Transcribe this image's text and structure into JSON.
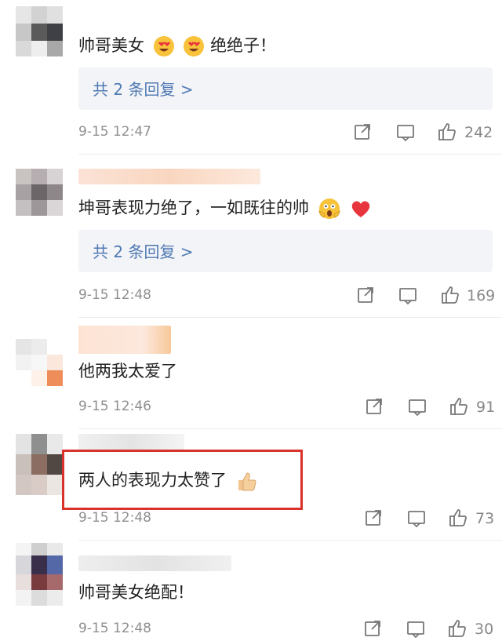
{
  "comments": [
    {
      "text": "帅哥美女",
      "text_after": "绝绝子！",
      "replies": "共 2 条回复 >",
      "time": "9-15 12:47",
      "likes": "242",
      "emoji": "heart-eyes-emoji"
    },
    {
      "text": "坤哥表现力绝了，一如既往的帅",
      "replies": "共 2 条回复 >",
      "time": "9-15 12:48",
      "likes": "169",
      "emoji": "scream-emoji"
    },
    {
      "text": "他两我太爱了",
      "time": "9-15 12:46",
      "likes": "91"
    },
    {
      "text": "两人的表现力太赞了",
      "time": "9-15 12:48",
      "likes": "73",
      "emoji": "thumbs-up-emoji"
    },
    {
      "text": "帅哥美女绝配！",
      "time": "9-15 12:48",
      "likes": "30"
    }
  ],
  "colors": {
    "link": "#4f79b4",
    "highlight": "#d8322b",
    "heart": "#e8343c"
  },
  "icons": [
    "share-icon",
    "comment-icon",
    "like-icon"
  ]
}
